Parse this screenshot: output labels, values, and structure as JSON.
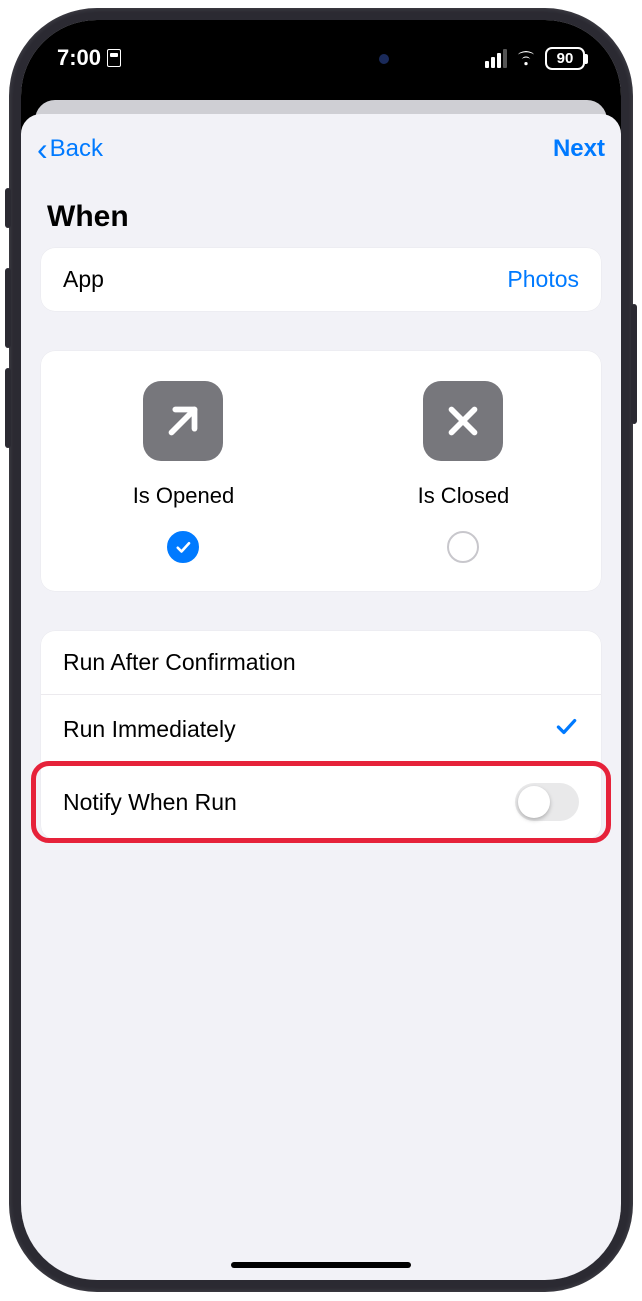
{
  "status": {
    "time": "7:00",
    "battery": "90"
  },
  "nav": {
    "back": "Back",
    "next": "Next"
  },
  "section_title": "When",
  "app_row": {
    "label": "App",
    "value": "Photos"
  },
  "triggers": {
    "opened": {
      "label": "Is Opened",
      "checked": true
    },
    "closed": {
      "label": "Is Closed",
      "checked": false
    }
  },
  "run_options": {
    "confirm": {
      "label": "Run After Confirmation",
      "selected": false
    },
    "immediate": {
      "label": "Run Immediately",
      "selected": true
    },
    "notify": {
      "label": "Notify When Run",
      "on": false
    }
  }
}
